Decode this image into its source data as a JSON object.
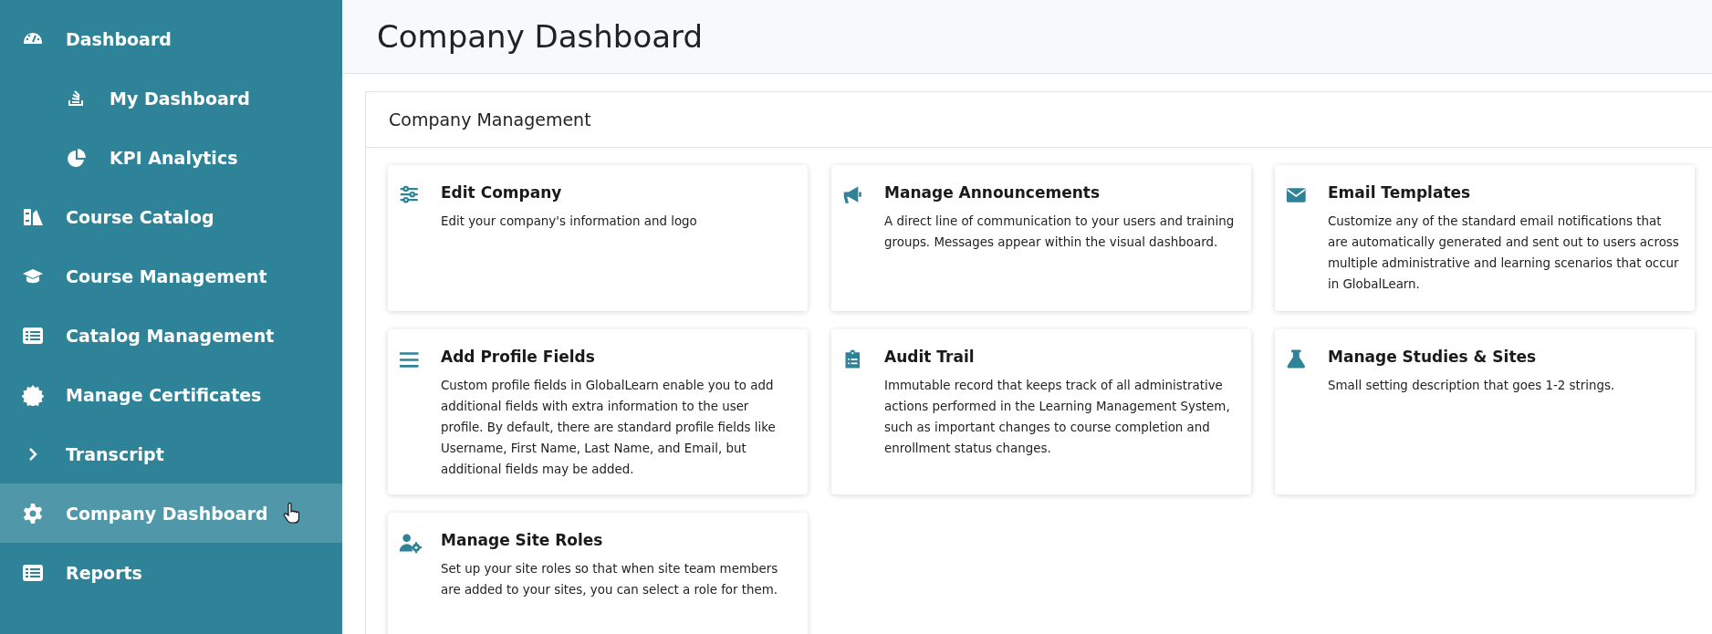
{
  "sidebar": {
    "items": [
      {
        "label": "Dashboard",
        "selected": false,
        "children": [
          {
            "label": "My Dashboard",
            "selected": false
          },
          {
            "label": "KPI Analytics",
            "selected": false
          }
        ]
      },
      {
        "label": "Course Catalog",
        "selected": false
      },
      {
        "label": "Course Management",
        "selected": false
      },
      {
        "label": "Catalog Management",
        "selected": false
      },
      {
        "label": "Manage Certificates",
        "selected": false
      },
      {
        "label": "Transcript",
        "selected": false,
        "expanded": false
      },
      {
        "label": "Company Dashboard",
        "selected": true
      },
      {
        "label": "Reports",
        "selected": false
      }
    ]
  },
  "page": {
    "title": "Company Dashboard"
  },
  "panel": {
    "title": "Company Management",
    "cards": [
      {
        "title": "Edit Company",
        "description": "Edit your company's information and logo"
      },
      {
        "title": "Manage Announcements",
        "description": "A direct line of communication to your users and training groups. Messages appear within the visual dashboard."
      },
      {
        "title": "Email Templates",
        "description": "Customize any of the standard email notifications that are automatically generated and sent out to users across multiple administrative and learning scenarios that occur in GlobalLearn."
      },
      {
        "title": "Add Profile Fields",
        "description": "Custom profile fields in GlobalLearn enable you to add additional fields with extra information to the user profile. By default, there are standard profile fields like Username, First Name, Last Name, and Email, but additional fields may be added."
      },
      {
        "title": "Audit Trail",
        "description": "Immutable record that keeps track of all administrative actions performed in the Learning Management System, such as important changes to course completion and enrollment status changes."
      },
      {
        "title": "Manage Studies & Sites",
        "description": "Small setting description that goes 1-2 strings."
      },
      {
        "title": "Manage Site Roles",
        "description": "Set up your site roles so that when site team members are added to your sites, you can select a role for them."
      }
    ]
  }
}
